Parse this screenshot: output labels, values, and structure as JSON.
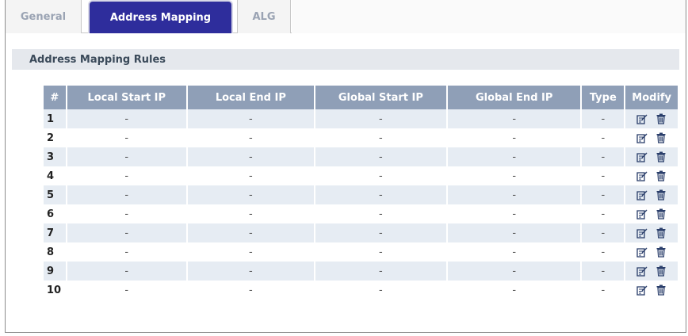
{
  "tabs": [
    {
      "label": "General",
      "active": false
    },
    {
      "label": "Address Mapping",
      "active": true
    },
    {
      "label": "ALG",
      "active": false
    }
  ],
  "section": {
    "title": "Address Mapping Rules"
  },
  "table": {
    "headers": [
      "#",
      "Local Start IP",
      "Local End IP",
      "Global Start IP",
      "Global End IP",
      "Type",
      "Modify"
    ],
    "rows": [
      {
        "index": "1",
        "local_start": "-",
        "local_end": "-",
        "global_start": "-",
        "global_end": "-",
        "type": "-"
      },
      {
        "index": "2",
        "local_start": "-",
        "local_end": "-",
        "global_start": "-",
        "global_end": "-",
        "type": "-"
      },
      {
        "index": "3",
        "local_start": "-",
        "local_end": "-",
        "global_start": "-",
        "global_end": "-",
        "type": "-"
      },
      {
        "index": "4",
        "local_start": "-",
        "local_end": "-",
        "global_start": "-",
        "global_end": "-",
        "type": "-"
      },
      {
        "index": "5",
        "local_start": "-",
        "local_end": "-",
        "global_start": "-",
        "global_end": "-",
        "type": "-"
      },
      {
        "index": "6",
        "local_start": "-",
        "local_end": "-",
        "global_start": "-",
        "global_end": "-",
        "type": "-"
      },
      {
        "index": "7",
        "local_start": "-",
        "local_end": "-",
        "global_start": "-",
        "global_end": "-",
        "type": "-"
      },
      {
        "index": "8",
        "local_start": "-",
        "local_end": "-",
        "global_start": "-",
        "global_end": "-",
        "type": "-"
      },
      {
        "index": "9",
        "local_start": "-",
        "local_end": "-",
        "global_start": "-",
        "global_end": "-",
        "type": "-"
      },
      {
        "index": "10",
        "local_start": "-",
        "local_end": "-",
        "global_start": "-",
        "global_end": "-",
        "type": "-"
      }
    ],
    "modify_icons": [
      "edit-icon",
      "delete-icon"
    ]
  },
  "colors": {
    "active_tab": "#2e2d9c",
    "header_bg": "#8f9fb7",
    "alt_row": "#e6ecf3",
    "section_bg": "#e5e8ed",
    "icon": "#2b3f6b"
  }
}
